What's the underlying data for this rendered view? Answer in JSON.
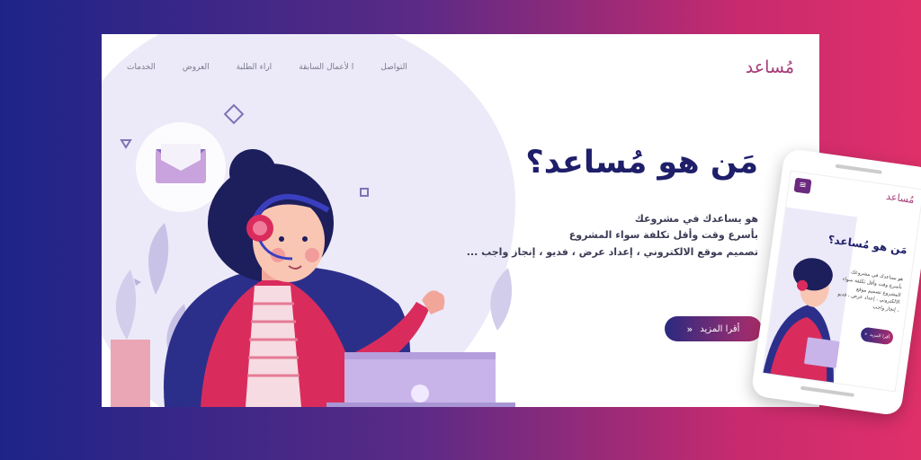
{
  "desktop": {
    "logo": "مُساعد",
    "nav": [
      "الخدمات",
      "العروض",
      "اراء الطلبة",
      "ا لأعمال السابقة",
      "التواصل"
    ],
    "hero": {
      "title": "مَن هو مُساعد؟",
      "lines": [
        "هو يساعدك في مشروعك",
        "بأسرع وقت وأقل تكلفة سواء المشروع",
        "تصميم موقع الالكتروني ، إعداد عرض ، فديو ، إنجاز واجب ..."
      ],
      "button_label": "أقرا المزيد",
      "button_icon": "«"
    }
  },
  "phone": {
    "menu_icon": "≡",
    "logo": "مُساعد",
    "title": "مَن هو مُساعد؟",
    "desc": "هو يساعدك في مشروعك بأسرع وقت وأقل تكلفة سواء المشروع تصميم موقع الالكتروني ، إعداد عرض ، فديو ، إنجاز واجب",
    "button_label": "أقرا المزيد",
    "button_icon": "«"
  },
  "colors": {
    "brand": "#a63a78",
    "title": "#1e1e6a",
    "gradient_start": "#1d2488",
    "gradient_end": "#e0306a"
  }
}
